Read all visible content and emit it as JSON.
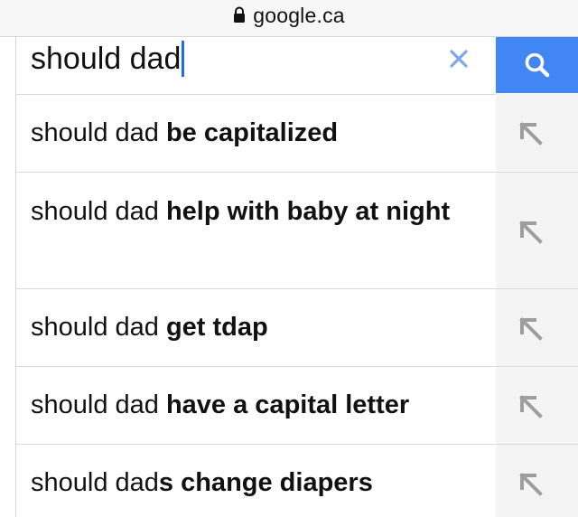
{
  "browser": {
    "url": "google.ca",
    "lock_icon": "lock-icon"
  },
  "search": {
    "query": "should dad",
    "clear_icon": "close-icon",
    "button_icon": "search-icon"
  },
  "suggestions": [
    {
      "prefix": "should dad",
      "completion": " be capitalized",
      "arrow_icon": "arrow-up-left-icon"
    },
    {
      "prefix": "should dad",
      "completion": " help with baby at night",
      "arrow_icon": "arrow-up-left-icon"
    },
    {
      "prefix": "should dad",
      "completion": " get tdap",
      "arrow_icon": "arrow-up-left-icon"
    },
    {
      "prefix": "should dad",
      "completion": " have a capital letter",
      "arrow_icon": "arrow-up-left-icon"
    },
    {
      "prefix": "should dad",
      "completion": "s change diapers",
      "arrow_icon": "arrow-up-left-icon"
    }
  ],
  "colors": {
    "accent": "#4285f4",
    "caret": "#1f6cf0",
    "clear": "#7ea7ec",
    "arrow": "#9e9e9e"
  }
}
